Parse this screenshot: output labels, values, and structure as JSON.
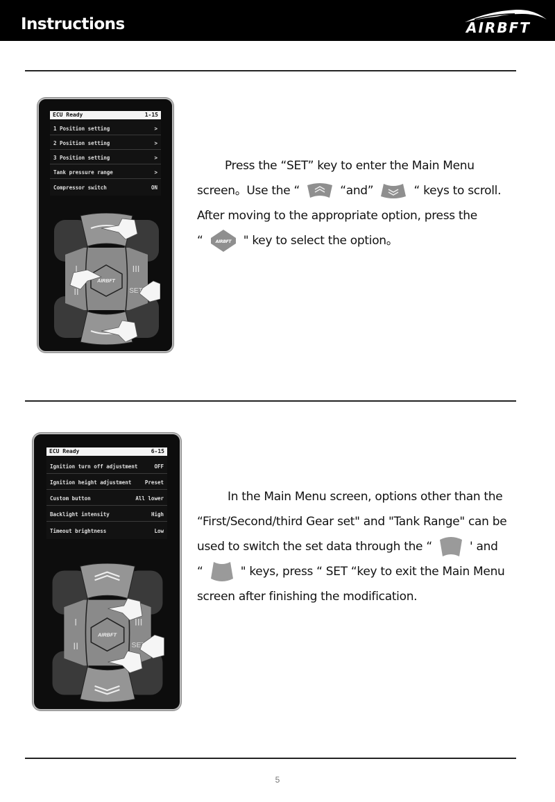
{
  "header": {
    "title": "Instructions",
    "logo_text": "AIRBFT"
  },
  "section1": {
    "screen": {
      "status": "ECU Ready",
      "page": "1-15",
      "items": [
        {
          "label": "1 Position setting",
          "value": ">"
        },
        {
          "label": "2 Position setting",
          "value": ">"
        },
        {
          "label": "3 Position setting",
          "value": ">"
        },
        {
          "label": "Tank pressure range",
          "value": ">"
        },
        {
          "label": "Compressor switch",
          "value": "ON"
        }
      ]
    },
    "keypad": {
      "left_top": "I",
      "left_bottom": "II",
      "right_top": "III",
      "right_bottom": "SET",
      "center_logo": "AIRBFT"
    },
    "text": {
      "line1": "Press the “SET” key to enter the Main Menu",
      "line2a": "screen。Use the “",
      "line2b": "“and”",
      "line2c": "“  keys to scroll.",
      "line3": "After moving to the appropriate option, press the",
      "line4a": "“",
      "line4b": "\" key to select the option。",
      "center_key_logo": "AIRBFT"
    }
  },
  "section2": {
    "screen": {
      "status": "ECU Ready",
      "page": "6-15",
      "items": [
        {
          "label": "Ignition turn off adjustment",
          "value": "OFF"
        },
        {
          "label": "Ignition height adjustment",
          "value": "Preset"
        },
        {
          "label": "Custom button",
          "value": "All lower"
        },
        {
          "label": "Backlight intensity",
          "value": "High"
        },
        {
          "label": "Timeout brightness",
          "value": "Low"
        }
      ]
    },
    "keypad": {
      "left_top": "I",
      "left_bottom": "II",
      "right_top": "III",
      "right_bottom": "SET",
      "center_logo": "AIRBFT"
    },
    "text": {
      "line1": "In the Main Menu screen, options other than the",
      "line2": "“First/Second/third Gear set\" and \"Tank Range\" can be",
      "line3a": "used to switch the set data through the “",
      "line3b": "' and",
      "line4a": "“",
      "line4b": "\" keys, press “  SET “key to exit the Main Menu",
      "line5": "screen after finishing the modification."
    }
  },
  "footer": {
    "page_number": "5"
  },
  "colors": {
    "header_bg": "#000000",
    "rule": "#222222",
    "key_gray": "#8f8f8f",
    "device_bg": "#0d0d0d"
  }
}
